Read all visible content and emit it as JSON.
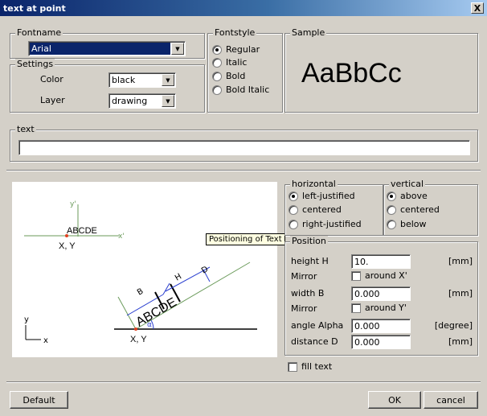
{
  "window": {
    "title": "text at point",
    "close_label": "X"
  },
  "fontname": {
    "legend": "Fontname",
    "selected": "Arial"
  },
  "settings": {
    "legend": "Settings",
    "color_label": "Color",
    "color_value": "black",
    "layer_label": "Layer",
    "layer_value": "drawing"
  },
  "fontstyle": {
    "legend": "Fontstyle",
    "options": [
      "Regular",
      "Italic",
      "Bold",
      "Bold Italic"
    ],
    "selected_index": 0
  },
  "sample": {
    "legend": "Sample",
    "text": "AaBbCc"
  },
  "text_group": {
    "legend": "text",
    "value": ""
  },
  "diagram": {
    "tooltip": "Positioning of Text",
    "upper_label": "ABCDE",
    "upper_origin": "X, Y",
    "axis_x_prime": "x'",
    "axis_y_prime": "y'",
    "rotated_label": "ABCDE",
    "lower_origin": "X, Y",
    "dim_b": "B",
    "dim_h": "H",
    "dim_d": "D",
    "alpha": "α",
    "axis_x": "x",
    "axis_y": "y"
  },
  "horizontal": {
    "legend": "horizontal",
    "options": [
      "left-justified",
      "centered",
      "right-justified"
    ],
    "selected_index": 0
  },
  "vertical": {
    "legend": "vertical",
    "options": [
      "above",
      "centered",
      "below"
    ],
    "selected_index": 0
  },
  "position": {
    "legend": "Position",
    "height_label": "height H",
    "height_value": "10.",
    "height_unit": "[mm]",
    "mirror1_label": "Mirror",
    "mirror1_check": "around X'",
    "width_label": "width B",
    "width_value": "0.000",
    "width_unit": "[mm]",
    "mirror2_label": "Mirror",
    "mirror2_check": "around Y'",
    "angle_label": "angle Alpha",
    "angle_value": "0.000",
    "angle_unit": "[degree]",
    "distance_label": "distance D",
    "distance_value": "0.000",
    "distance_unit": "[mm]"
  },
  "fill_text": {
    "label": "fill text",
    "checked": false
  },
  "buttons": {
    "default": "Default",
    "ok": "OK",
    "cancel": "cancel"
  }
}
